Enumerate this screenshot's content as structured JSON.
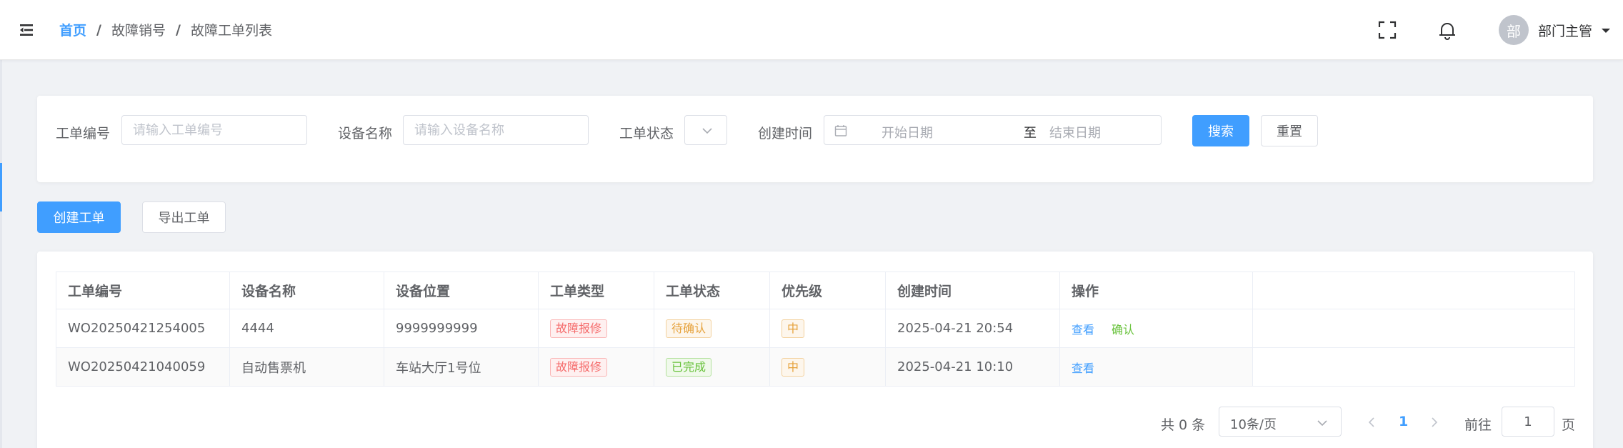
{
  "breadcrumb": [
    "首页",
    "故障销号",
    "故障工单列表"
  ],
  "header": {
    "fullscreen_icon": "fullscreen-icon",
    "bell_icon": "bell-icon",
    "avatar_text": "部",
    "username": "部门主管"
  },
  "search": {
    "order_no_label": "工单编号",
    "order_no_placeholder": "请输入工单编号",
    "device_label": "设备名称",
    "device_placeholder": "请输入设备名称",
    "status_label": "工单状态",
    "status_value": "",
    "created_label": "创建时间",
    "start_placeholder": "开始日期",
    "range_sep": "至",
    "end_placeholder": "结束日期",
    "search_btn": "搜索",
    "reset_btn": "重置"
  },
  "actions": {
    "create_btn": "创建工单",
    "export_btn": "导出工单"
  },
  "table": {
    "columns": [
      "工单编号",
      "设备名称",
      "设备位置",
      "工单类型",
      "工单状态",
      "优先级",
      "创建时间",
      "操作"
    ],
    "rows": [
      {
        "order_no": "WO20250421254005",
        "device": "4444",
        "location": "9999999999",
        "type": "故障报修",
        "status": "待确认",
        "priority": "中",
        "created": "2025-04-21 20:54",
        "ops": [
          "查看",
          "确认"
        ]
      },
      {
        "order_no": "WO20250421040059",
        "device": "自动售票机",
        "location": "车站大厅1号位",
        "type": "故障报修",
        "status": "已完成",
        "priority": "中",
        "created": "2025-04-21 10:10",
        "ops": [
          "查看"
        ]
      }
    ]
  },
  "pagination": {
    "total_text": "共 0 条",
    "page_size": "10条/页",
    "current_page": "1",
    "goto_label": "前往",
    "goto_value": "1",
    "page_suffix": "页"
  },
  "colors": {
    "primary": "#409eff",
    "danger": "#f56c6c",
    "warning": "#e6a23c",
    "success": "#67c23a"
  }
}
